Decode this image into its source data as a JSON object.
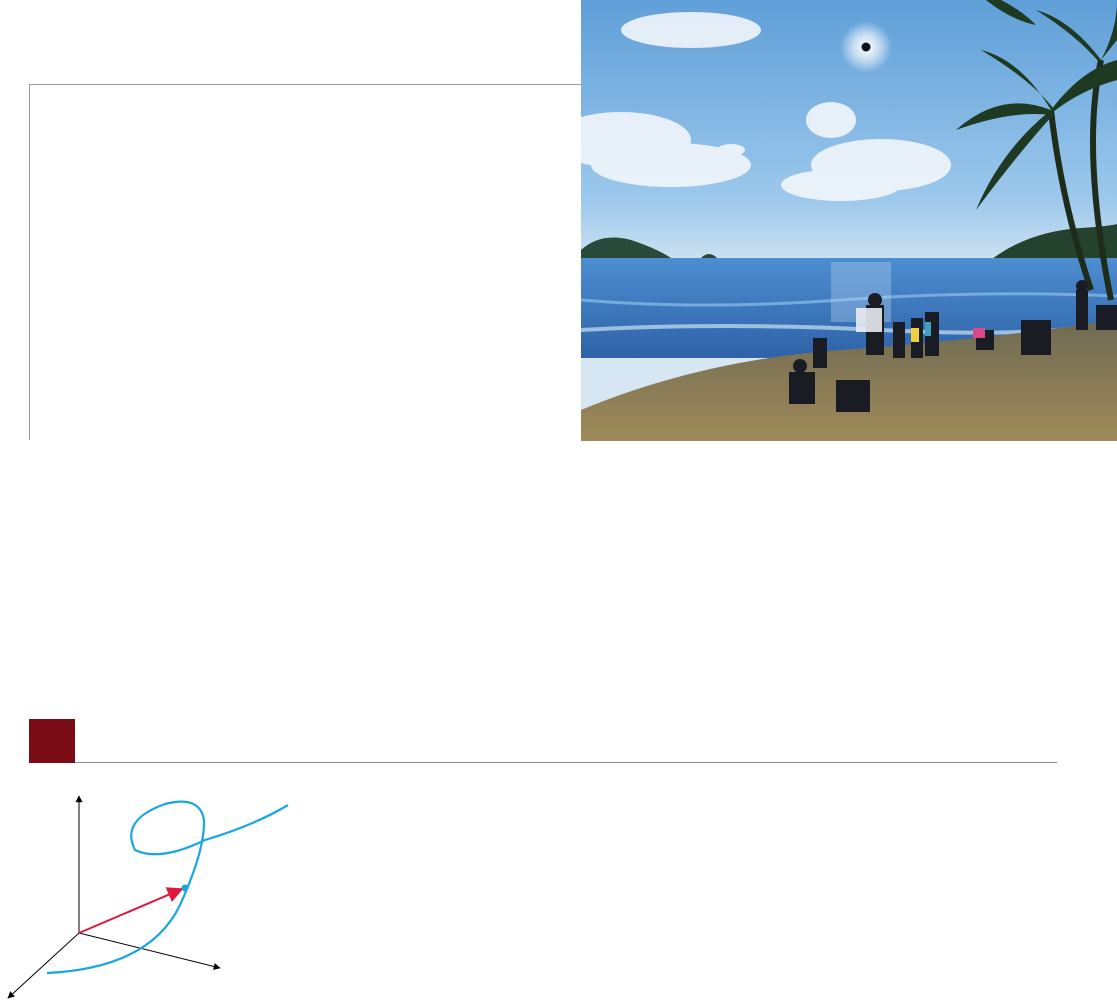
{
  "photo": {
    "subject": "eclipse-beach-photo"
  },
  "section": {
    "marker_color": "#7a0c16",
    "rule_color": "#8c8c8c"
  },
  "diagram": {
    "axis_color": "#000000",
    "curve_color": "#1aa7e0",
    "vector_color": "#e0193c",
    "point_color": "#1aa7e0"
  }
}
